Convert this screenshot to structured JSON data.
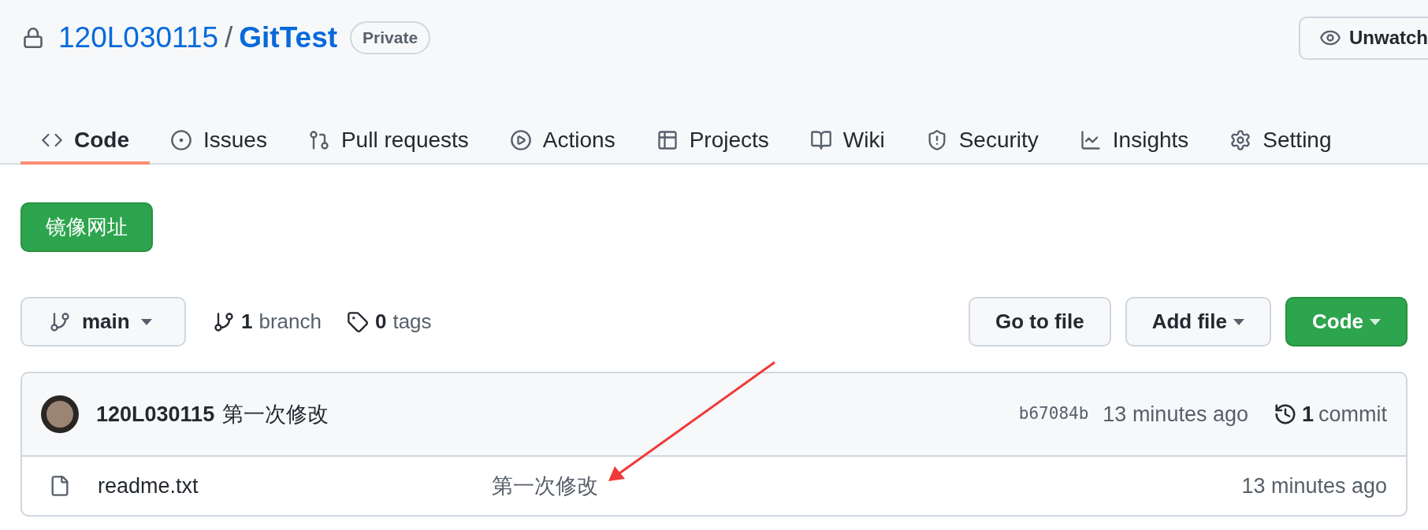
{
  "repo": {
    "owner": "120L030115",
    "separator": "/",
    "name": "GitTest",
    "visibility": "Private"
  },
  "watch_button": {
    "label": "Unwatch"
  },
  "tabs": [
    {
      "label": "Code",
      "selected": true
    },
    {
      "label": "Issues",
      "selected": false
    },
    {
      "label": "Pull requests",
      "selected": false
    },
    {
      "label": "Actions",
      "selected": false
    },
    {
      "label": "Projects",
      "selected": false
    },
    {
      "label": "Wiki",
      "selected": false
    },
    {
      "label": "Security",
      "selected": false
    },
    {
      "label": "Insights",
      "selected": false
    },
    {
      "label": "Setting",
      "selected": false
    }
  ],
  "mirror_button": {
    "label": "镜像网址"
  },
  "branch_selector": {
    "label": "main"
  },
  "branch_count": {
    "count": "1",
    "label": "branch"
  },
  "tag_count": {
    "count": "0",
    "label": "tags"
  },
  "actions": [
    {
      "kind": "plain",
      "label": "Go to file"
    },
    {
      "kind": "dropdown",
      "label": "Add file"
    },
    {
      "kind": "primary",
      "label": "Code"
    }
  ],
  "latest_commit": {
    "author": "120L030115",
    "message": "第一次修改",
    "sha": "b67084b",
    "time": "13 minutes ago",
    "commit_count": "1",
    "commit_label": "commit"
  },
  "files": [
    {
      "name": "readme.txt",
      "message": "第一次修改",
      "time": "13 minutes ago"
    }
  ]
}
